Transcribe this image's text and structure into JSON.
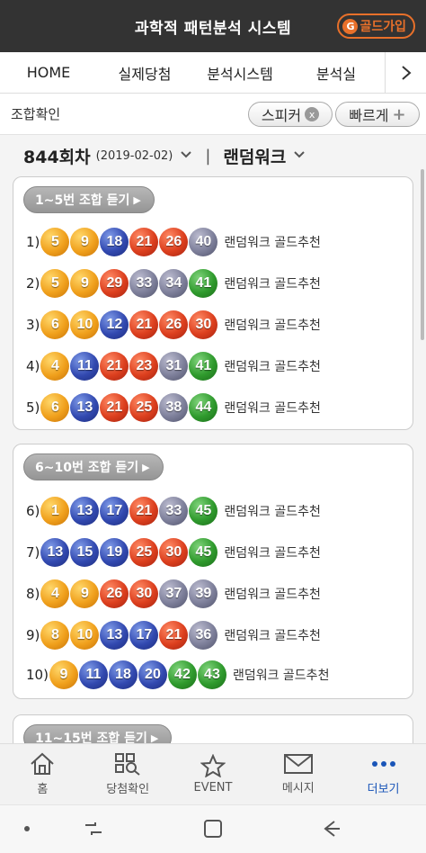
{
  "header": {
    "title": "과학적 패턴분석 시스템",
    "gold_icon": "G",
    "gold_label": "골드가입"
  },
  "nav": {
    "tabs": [
      "HOME",
      "실제당첨",
      "분석시스템",
      "분석실"
    ],
    "more_icon": "chevron-right-icon"
  },
  "subbar": {
    "label": "조합확인",
    "speaker_label": "스피커",
    "speaker_icon": "x",
    "fast_label": "빠르게",
    "fast_icon": "+"
  },
  "round": {
    "number": "844회차",
    "date": "(2019-02-02)",
    "separator": "|",
    "method": "랜덤워크"
  },
  "groups": [
    {
      "title": "1∼5번 조합 듣기",
      "rows": [
        {
          "index": "1)",
          "balls": [
            5,
            9,
            18,
            21,
            26,
            40
          ],
          "desc": "랜덤워크 골드추천"
        },
        {
          "index": "2)",
          "balls": [
            5,
            9,
            29,
            33,
            34,
            41
          ],
          "desc": "랜덤워크 골드추천"
        },
        {
          "index": "3)",
          "balls": [
            6,
            10,
            12,
            21,
            26,
            30
          ],
          "desc": "랜덤워크 골드추천"
        },
        {
          "index": "4)",
          "balls": [
            4,
            11,
            21,
            23,
            31,
            41
          ],
          "desc": "랜덤워크 골드추천"
        },
        {
          "index": "5)",
          "balls": [
            6,
            13,
            21,
            25,
            38,
            44
          ],
          "desc": "랜덤워크 골드추천"
        }
      ]
    },
    {
      "title": "6∼10번 조합 듣기",
      "rows": [
        {
          "index": "6)",
          "balls": [
            1,
            13,
            17,
            21,
            33,
            45
          ],
          "desc": "랜덤워크 골드추천"
        },
        {
          "index": "7)",
          "balls": [
            13,
            15,
            19,
            25,
            30,
            45
          ],
          "desc": "랜덤워크 골드추천"
        },
        {
          "index": "8)",
          "balls": [
            4,
            9,
            26,
            30,
            37,
            39
          ],
          "desc": "랜덤워크 골드추천"
        },
        {
          "index": "9)",
          "balls": [
            8,
            10,
            13,
            17,
            21,
            36
          ],
          "desc": "랜덤워크 골드추천"
        },
        {
          "index": "10)",
          "balls": [
            9,
            11,
            18,
            20,
            42,
            43
          ],
          "desc": "랜덤워크 골드추천"
        }
      ]
    },
    {
      "title": "11∼15번 조합 듣기"
    }
  ],
  "bottom_nav": [
    {
      "label": "홈",
      "icon": "home-icon"
    },
    {
      "label": "당첨확인",
      "icon": "qr-scan-icon"
    },
    {
      "label": "EVENT",
      "icon": "star-icon"
    },
    {
      "label": "메시지",
      "icon": "mail-icon"
    },
    {
      "label": "더보기",
      "icon": "more-dots-icon",
      "active": true
    }
  ],
  "colors": {
    "accent": "#e8702a",
    "active": "#1a55b8",
    "yellow": "#f0a01c",
    "blue": "#3249b0",
    "red": "#dc3f1e",
    "gray": "#7d7f9a",
    "green": "#2f9a2d"
  }
}
